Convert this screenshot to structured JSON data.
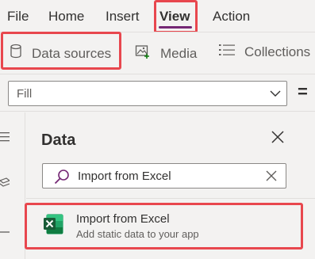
{
  "menubar": {
    "items": [
      {
        "label": "File"
      },
      {
        "label": "Home"
      },
      {
        "label": "Insert"
      },
      {
        "label": "View",
        "active": true
      },
      {
        "label": "Action"
      }
    ]
  },
  "toolbar": {
    "data_sources_label": "Data sources",
    "media_label": "Media",
    "collections_label": "Collections"
  },
  "formula": {
    "property_value": "Fill",
    "equals": "="
  },
  "data_pane": {
    "title": "Data",
    "search_value": "Import from Excel",
    "result": {
      "title": "Import from Excel",
      "subtitle": "Add static data to your app"
    }
  },
  "colors": {
    "accent": "#742774",
    "highlight": "#e8474e",
    "excel_green": "#217346"
  }
}
